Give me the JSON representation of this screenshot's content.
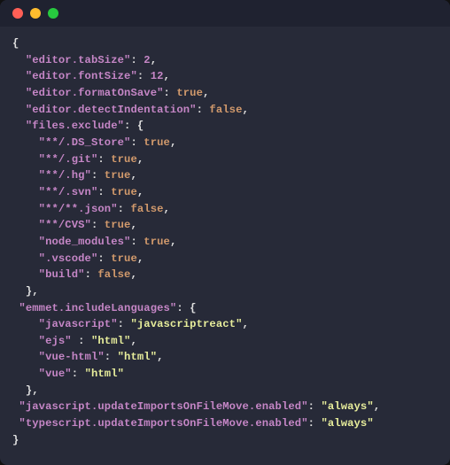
{
  "settings": {
    "editor.tabSize": 2,
    "editor.fontSize": 12,
    "editor.formatOnSave": true,
    "editor.detectIndentation": false,
    "files.exclude": {
      "**/.DS_Store": true,
      "**/.git": true,
      "**/.hg": true,
      "**/.svn": true,
      "**/**.json": false,
      "**/CVS": true,
      "node_modules": true,
      ".vscode": true,
      "build": false
    },
    "emmet.includeLanguages": {
      "javascript": "javascriptreact",
      "ejs": "html",
      "vue-html": "html",
      "vue": "html"
    },
    "javascript.updateImportsOnFileMove.enabled": "always",
    "typescript.updateImportsOnFileMove.enabled": "always"
  },
  "ejsSpacing": true,
  "trailingCommaInFilesExclude": true
}
